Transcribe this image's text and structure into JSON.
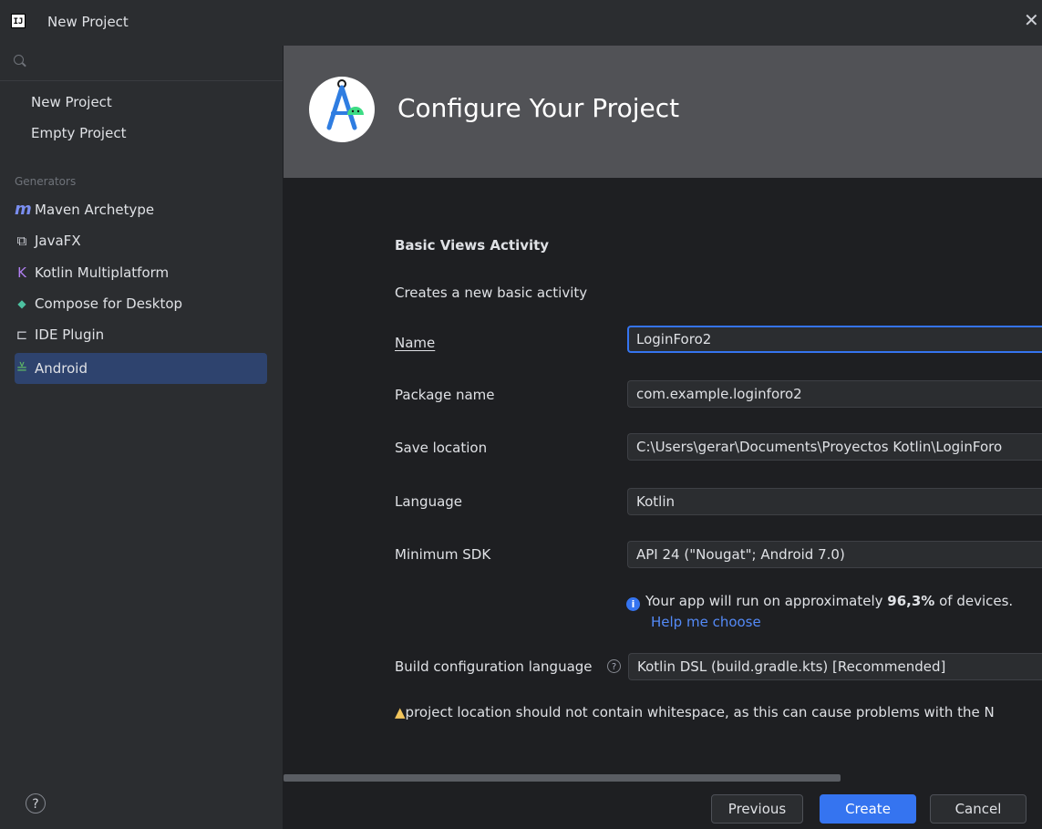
{
  "window": {
    "title": "New Project",
    "app_icon": "IJ",
    "close": "✕"
  },
  "sidebar": {
    "items": [
      {
        "label": "New Project"
      },
      {
        "label": "Empty Project"
      }
    ],
    "section_label": "Generators",
    "generators": [
      {
        "label": "Maven Archetype",
        "icon": "maven-icon",
        "glyph": "m"
      },
      {
        "label": "JavaFX",
        "icon": "javafx-icon",
        "glyph": "⧉"
      },
      {
        "label": "Kotlin Multiplatform",
        "icon": "kotlin-multiplatform-icon",
        "glyph": "K"
      },
      {
        "label": "Compose for Desktop",
        "icon": "compose-icon",
        "glyph": "◆"
      },
      {
        "label": "IDE Plugin",
        "icon": "plugin-icon",
        "glyph": "⊏"
      },
      {
        "label": "Android",
        "icon": "android-icon",
        "glyph": "≚",
        "selected": true
      }
    ],
    "help": "?"
  },
  "banner": {
    "title": "Configure Your Project"
  },
  "form": {
    "activity_title": "Basic Views Activity",
    "activity_description": "Creates a new basic activity",
    "fields": {
      "name": {
        "label": "Name",
        "value": "LoginForo2"
      },
      "package": {
        "label": "Package name",
        "value": "com.example.loginforo2"
      },
      "save_location": {
        "label": "Save location",
        "value": "C:\\Users\\gerar\\Documents\\Proyectos Kotlin\\LoginForo"
      },
      "language": {
        "label": "Language",
        "value": "Kotlin"
      },
      "min_sdk": {
        "label": "Minimum SDK",
        "value": "API 24 (\"Nougat\"; Android 7.0)"
      },
      "build_config": {
        "label": "Build configuration language",
        "value": "Kotlin DSL (build.gradle.kts) [Recommended]"
      }
    },
    "info": {
      "prefix": "Your app will run on approximately ",
      "percent": "96,3%",
      "suffix": " of devices.",
      "help_link": "Help me choose"
    },
    "warning": "project location should not contain whitespace, as this can cause problems with the N"
  },
  "buttons": {
    "previous": "Previous",
    "create": "Create",
    "cancel": "Cancel"
  },
  "colors": {
    "accent": "#3574f0",
    "selection": "#2e436e",
    "warning": "#f2c55c",
    "link": "#548af7"
  }
}
